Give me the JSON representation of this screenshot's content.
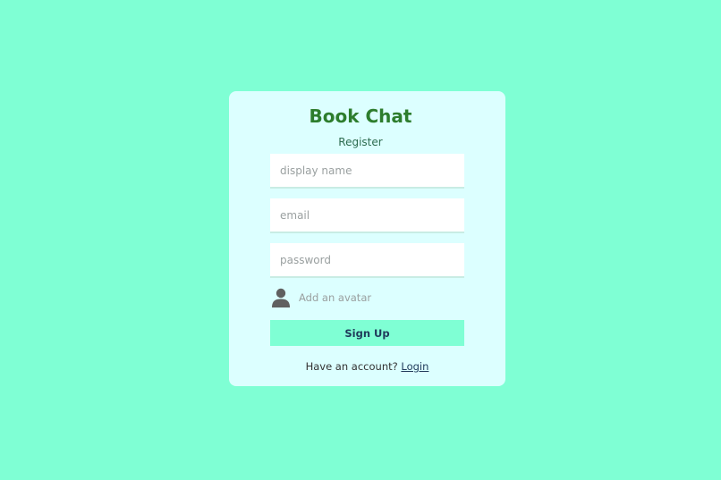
{
  "app": {
    "logo": "Book Chat",
    "title": "Register"
  },
  "form": {
    "display_name": {
      "placeholder": "display name",
      "value": ""
    },
    "email": {
      "placeholder": "email",
      "value": ""
    },
    "password": {
      "placeholder": "password",
      "value": ""
    },
    "avatar": {
      "label": "Add an avatar",
      "icon": "user-icon"
    },
    "submit_label": "Sign Up"
  },
  "footer": {
    "prompt": "Have an account? ",
    "link_label": "Login"
  },
  "colors": {
    "background": "#7fffd4",
    "card": "#dcffff",
    "logo": "#2d7d2d",
    "button": "#7fffd4",
    "icon": "#606060"
  }
}
